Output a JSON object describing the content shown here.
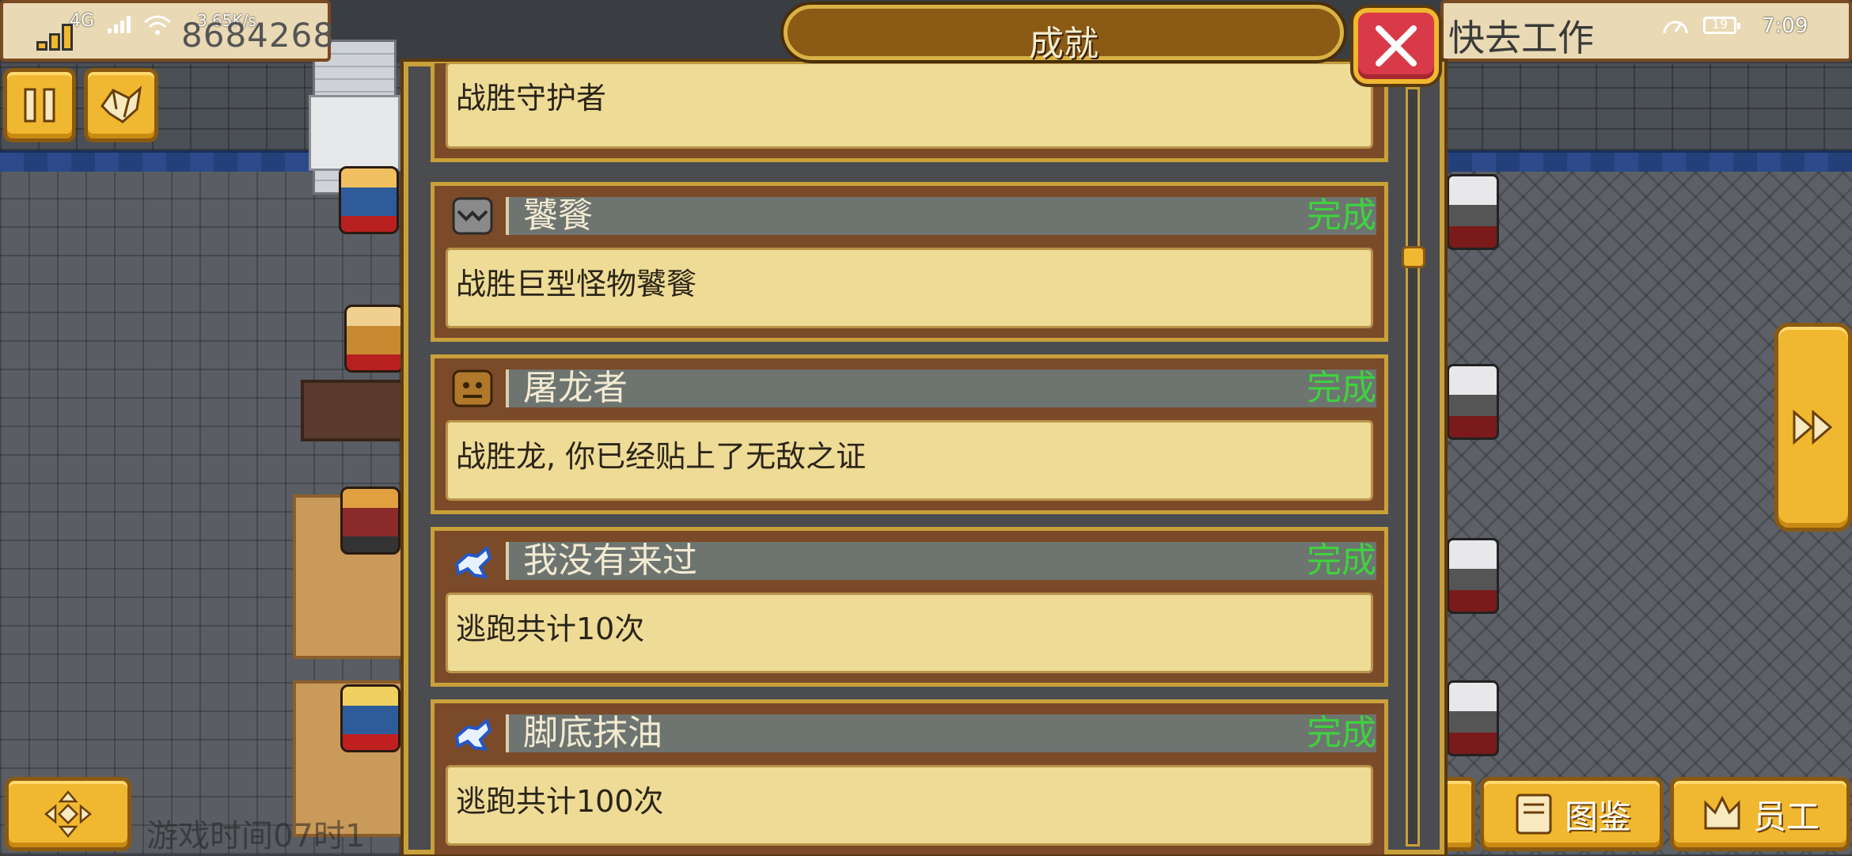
{
  "status_bar": {
    "gold_amount": "8684268",
    "network": "4G",
    "speed": "3.65K/s",
    "clock": "7:09",
    "battery": "19"
  },
  "hud": {
    "work_prompt": "快去工作"
  },
  "modal": {
    "title": "成就",
    "close_icon": "close-icon"
  },
  "achievements": [
    {
      "name": "",
      "description": "战胜守护者",
      "status": "",
      "icon": "partial-icon"
    },
    {
      "name": "饕餮",
      "description": "战胜巨型怪物饕餮",
      "status": "完成",
      "icon": "beast-icon"
    },
    {
      "name": "屠龙者",
      "description": "战胜龙, 你已经贴上了无敌之证",
      "status": "完成",
      "icon": "dragon-icon"
    },
    {
      "name": "我没有来过",
      "description": "逃跑共计10次",
      "status": "完成",
      "icon": "runner-icon"
    },
    {
      "name": "脚底抹油",
      "description": "逃跑共计100次",
      "status": "完成",
      "icon": "runner-icon"
    }
  ],
  "buttons": {
    "encyclopedia": "图鉴",
    "staff": "员工"
  },
  "bottom_tip": "游戏时间07时1",
  "colors": {
    "accent_gold": "#f0b830",
    "complete_green": "#3ed23e",
    "close_red": "#d83a48"
  }
}
